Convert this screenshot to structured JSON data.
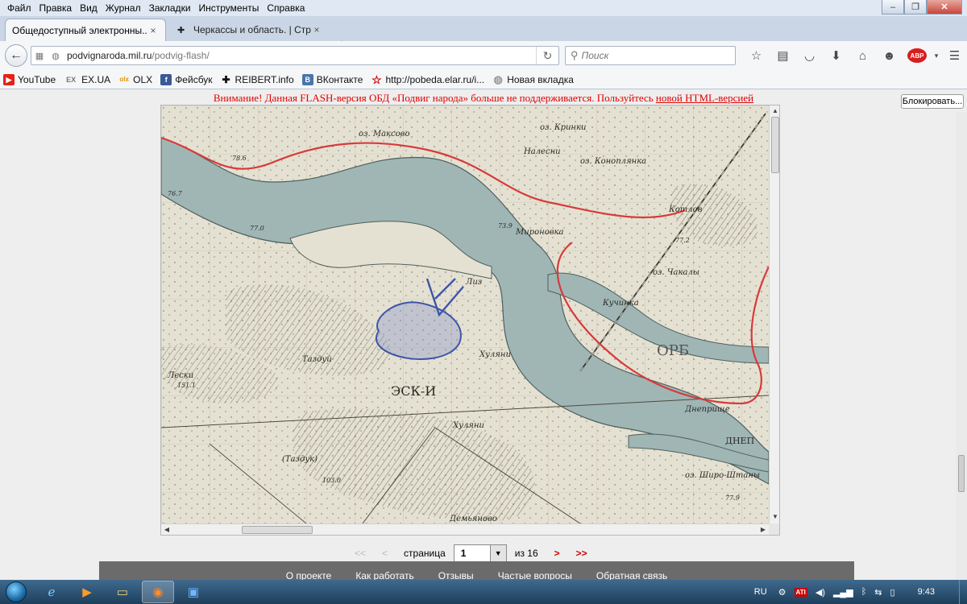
{
  "menu": [
    "Файл",
    "Правка",
    "Вид",
    "Журнал",
    "Закладки",
    "Инструменты",
    "Справка"
  ],
  "window_buttons": {
    "minimize": "–",
    "maximize": "❐",
    "close": "✕"
  },
  "tabs": [
    {
      "title": "Общедоступный электронны...",
      "close": "×"
    },
    {
      "title": "Черкассы и область. | Стр...",
      "close": "×"
    }
  ],
  "new_tab": "+",
  "url": {
    "domain": "podvignaroda.mil.ru",
    "path": "/podvig-flash/"
  },
  "search": {
    "placeholder": "Поиск"
  },
  "abp_label": "ABP",
  "bookmarks": [
    {
      "label": "YouTube",
      "icon": "youtube-icon",
      "color": "#e62117",
      "glyph": "▶"
    },
    {
      "label": "EX.UA",
      "icon": "exua-icon",
      "color": "#777777",
      "glyph": "EX"
    },
    {
      "label": "OLX",
      "icon": "olx-icon",
      "color": "#ffa500",
      "glyph": "olx"
    },
    {
      "label": "Фейсбук",
      "icon": "facebook-icon",
      "color": "#3b5998",
      "glyph": "f"
    },
    {
      "label": "REIBERT.info",
      "icon": "reibert-icon",
      "color": "#111111",
      "glyph": "✚"
    },
    {
      "label": "ВКонтакте",
      "icon": "vk-icon",
      "color": "#4a76a8",
      "glyph": "B"
    },
    {
      "label": "http://pobeda.elar.ru/i...",
      "icon": "star-icon",
      "color": "#cc0000",
      "glyph": "☆"
    },
    {
      "label": "Новая вкладка",
      "icon": "globe-icon",
      "color": "#9a9a9a",
      "glyph": "◍"
    }
  ],
  "banner": {
    "text": "Внимание! Данная FLASH-версия ОБД «Подвиг народа» больше не поддерживается. Пользуйтесь ",
    "link": "новой HTML-версией"
  },
  "block_button": "Блокировать...",
  "map_labels": [
    "оз. Максово",
    "оз. Кринки",
    "Налесни",
    "оз. Коноплянка",
    "Котлов",
    "Мироновка",
    "оз. Чакалы",
    "Кучинка",
    "Таздуй",
    "ЭСК-И",
    "Хуляни",
    "Лески",
    "Лиз",
    "Хуляни",
    "(Таздук)",
    "Днеприще",
    "оз. Широ-Штаны",
    "ДНЕП",
    "ОРБ",
    "Демьяново",
    "78.6",
    "76.7",
    "77.0",
    "73.9",
    "77.2",
    "103.0",
    "151.1",
    "77.9"
  ],
  "pager": {
    "first": "<<",
    "prev": "<",
    "label_page": "страница",
    "current": "1",
    "label_of": "из 16",
    "next": ">",
    "last": ">>"
  },
  "footer_links": [
    "О проекте",
    "Как работать",
    "Отзывы",
    "Частые вопросы",
    "Обратная связь"
  ],
  "tray": {
    "lang": "RU",
    "time": "9:43",
    "ati": "ATI"
  },
  "colors": {
    "banner": "#e00000",
    "map_paper": "#e5e1d2",
    "river": "#9fb6b5",
    "border_line": "#d83a3a",
    "pen": "#3e55a8"
  }
}
